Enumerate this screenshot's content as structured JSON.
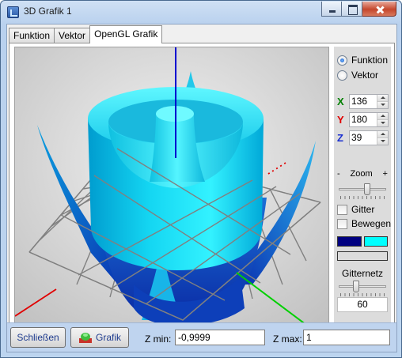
{
  "window": {
    "title": "3D Grafik 1"
  },
  "tabs": [
    {
      "label": "Funktion",
      "active": false
    },
    {
      "label": "Vektor",
      "active": false
    },
    {
      "label": "OpenGL Grafik",
      "active": true
    }
  ],
  "side": {
    "mode_options": [
      "Funktion",
      "Vektor"
    ],
    "mode_selected": "Funktion",
    "rotation": [
      {
        "axis": "X",
        "value": "136",
        "color": "#008000"
      },
      {
        "axis": "Y",
        "value": "180",
        "color": "#e00000"
      },
      {
        "axis": "Z",
        "value": "39",
        "color": "#1a2fd0"
      }
    ],
    "zoom": {
      "minus": "-",
      "label": "Zoom",
      "plus": "+",
      "level": 0.6
    },
    "gitter_label": "Gitter",
    "bewegen_label": "Bewegen",
    "color_low": "#000080",
    "color_high": "#00ffff",
    "gitternetz_label": "Gitternetz",
    "gitternetz_level": 0.35,
    "gitternetz_value": "60"
  },
  "bottom": {
    "close_label": "Schließen",
    "grafik_label": "Grafik",
    "zmin_label": "Z min:",
    "zmin_value": "-0,9999",
    "zmax_label": "Z max:",
    "zmax_value": "1"
  },
  "viewport": {
    "axis_x_color": "#e00000",
    "axis_y_color": "#00d000",
    "axis_z_color": "#0000d0",
    "grid_color": "#808080"
  }
}
